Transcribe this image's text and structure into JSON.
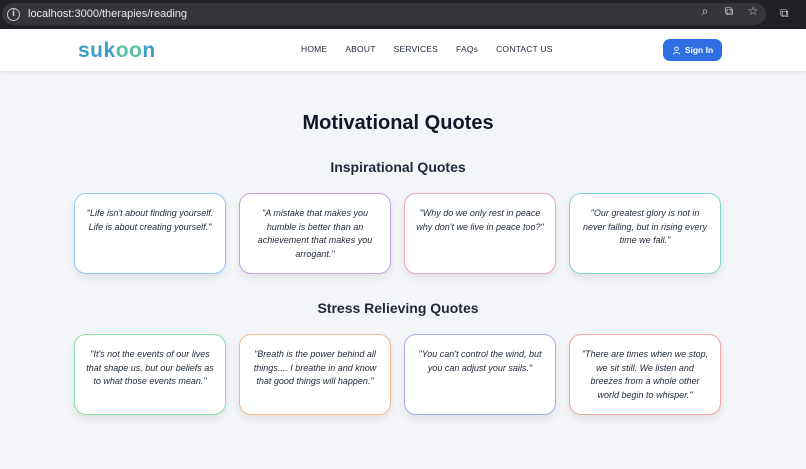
{
  "browser": {
    "url": "localhost:3000/therapies/reading"
  },
  "header": {
    "logo_part1": "suk",
    "logo_part2": "oo",
    "logo_part3": "n",
    "nav": [
      "HOME",
      "ABOUT",
      "SERVICES",
      "FAQs",
      "CONTACT US"
    ],
    "signin_label": "Sign In",
    "brand_color": "#2f6fe4"
  },
  "main": {
    "title": "Motivational Quotes",
    "sections": [
      {
        "title": "Inspirational Quotes",
        "quotes": [
          {
            "text": "\"Life isn't about finding yourself. Life is about creating yourself.\"",
            "border": "#93c5fd"
          },
          {
            "text": "\"A mistake that makes you humble is better than an achievement that makes you arrogant.\"",
            "border": "#c4a0ea"
          },
          {
            "text": "\"Why do we only rest in peace why don't we live in peace too?\"",
            "border": "#f0a4c8"
          },
          {
            "text": "\"Our greatest glory is not in never falling, but in rising every time we fall.\"",
            "border": "#7fd6cf"
          }
        ]
      },
      {
        "title": "Stress Relieving Quotes",
        "quotes": [
          {
            "text": "\"It's not the events of our lives that shape us, but our beliefs as to what those events mean.\"",
            "border": "#86e0a4"
          },
          {
            "text": "\"Breath is the power behind all things.... I breathe in and know that good things will happen.\"",
            "border": "#f7b98a"
          },
          {
            "text": "\"You can't control the wind, but you can adjust your sails.\"",
            "border": "#a9aef0"
          },
          {
            "text": "\"There are times when we stop, we sit still. We listen and breezes from a whole other world begin to whisper.\"",
            "border": "#f2a3a8"
          }
        ]
      }
    ]
  }
}
